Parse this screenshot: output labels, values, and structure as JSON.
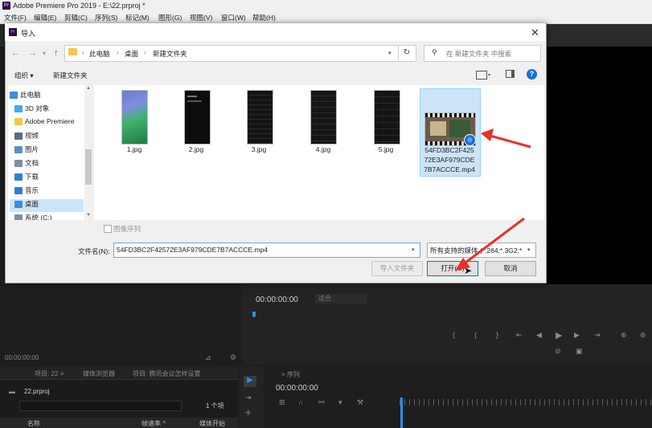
{
  "app": {
    "logo": "Pr",
    "title": "Adobe Premiere Pro 2019 - E:\\22.prproj *"
  },
  "menu": [
    "文件(F)",
    "编辑(E)",
    "剪辑(C)",
    "序列(S)",
    "标记(M)",
    "图形(G)",
    "视图(V)",
    "窗口(W)",
    "帮助(H)"
  ],
  "dialog": {
    "icon": "Pr",
    "title": "导入",
    "close_glyph": "✕",
    "breadcrumb": [
      "此电脑",
      "桌面",
      "新建文件夹"
    ],
    "search_placeholder": "在 新建文件夹 中搜索",
    "toolbar": {
      "organize": "组织 ▾",
      "new_folder": "新建文件夹"
    },
    "help": "?",
    "nav_tree": [
      {
        "label": "此电脑",
        "icon": "computer-icon",
        "color": "#3a8de0"
      },
      {
        "label": "3D 对象",
        "icon": "3d-objects-icon",
        "color": "#3fa9f5"
      },
      {
        "label": "Adobe Premiere",
        "icon": "folder-icon",
        "color": "#f2c84b"
      },
      {
        "label": "视频",
        "icon": "video-icon",
        "color": "#5a6b7b"
      },
      {
        "label": "图片",
        "icon": "pictures-icon",
        "color": "#5b8fc9"
      },
      {
        "label": "文档",
        "icon": "documents-icon",
        "color": "#7a8fa6"
      },
      {
        "label": "下载",
        "icon": "download-icon",
        "color": "#2f7fd3"
      },
      {
        "label": "音乐",
        "icon": "music-icon",
        "color": "#2f7fd3"
      },
      {
        "label": "桌面",
        "icon": "desktop-icon",
        "color": "#3a8de0"
      },
      {
        "label": "系统 (C:)",
        "icon": "drive-icon",
        "color": "#7a8fa6"
      }
    ],
    "files": [
      {
        "name": "1.jpg"
      },
      {
        "name": "2.jpg"
      },
      {
        "name": "3.jpg"
      },
      {
        "name": "4.jpg"
      },
      {
        "name": "5.jpg"
      }
    ],
    "video_file": {
      "line1": "54FD3BC2F425",
      "line2": "72E3AF979CDE",
      "line3": "7B7ACCCE.mp4"
    },
    "image_sequence_label": "图像序列",
    "filename_label": "文件名(N):",
    "filename_value": "54FD3BC2F42572E3AF979CDE7B7ACCCE.mp4",
    "filetype_value": "所有支持的媒体 (*.264;*.3G2;*",
    "buttons": {
      "import_folder": "导入文件夹",
      "open": "打开(O)",
      "cancel": "取消"
    }
  },
  "panels": {
    "source_timecode": "00:00:00:00",
    "program_timecode": "00:00:00:00",
    "program_fit": "适合",
    "project_tabs": [
      "项目: 22 ≡",
      "媒体浏览器",
      "项目: 腾讯会议怎样设置"
    ],
    "project_file": "22.prproj",
    "project_count": "1 个项",
    "project_headers": [
      "名称",
      "帧速率 ^",
      "媒体开始"
    ],
    "timeline_tab": "× 序列",
    "timeline_timecode": "00:00:00:00"
  },
  "colors": {
    "accent_blue": "#2d8ceb",
    "annotation_red": "#e8302a",
    "selection": "#cce4f7"
  }
}
